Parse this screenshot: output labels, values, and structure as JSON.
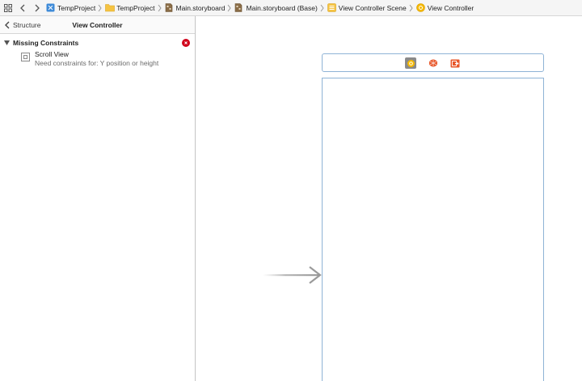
{
  "jumpbar": {
    "crumbs": [
      {
        "label": "TempProject",
        "icon": "xcode-project-icon"
      },
      {
        "label": "TempProject",
        "icon": "folder-icon"
      },
      {
        "label": "Main.storyboard",
        "icon": "storyboard-file-icon"
      },
      {
        "label": "Main.storyboard (Base)",
        "icon": "storyboard-file-icon"
      },
      {
        "label": "View Controller Scene",
        "icon": "scene-icon"
      },
      {
        "label": "View Controller",
        "icon": "view-controller-icon"
      }
    ]
  },
  "issues_panel": {
    "back_label": "Structure",
    "title": "View Controller",
    "group": {
      "title": "Missing Constraints",
      "items": [
        {
          "name": "Scroll View",
          "description": "Need constraints for: Y position or height"
        }
      ]
    }
  },
  "colors": {
    "accent_blue": "#8fb3d6",
    "error_red": "#d0021b",
    "scene_yellow": "#f5b800",
    "scene_orange": "#e8572a"
  }
}
